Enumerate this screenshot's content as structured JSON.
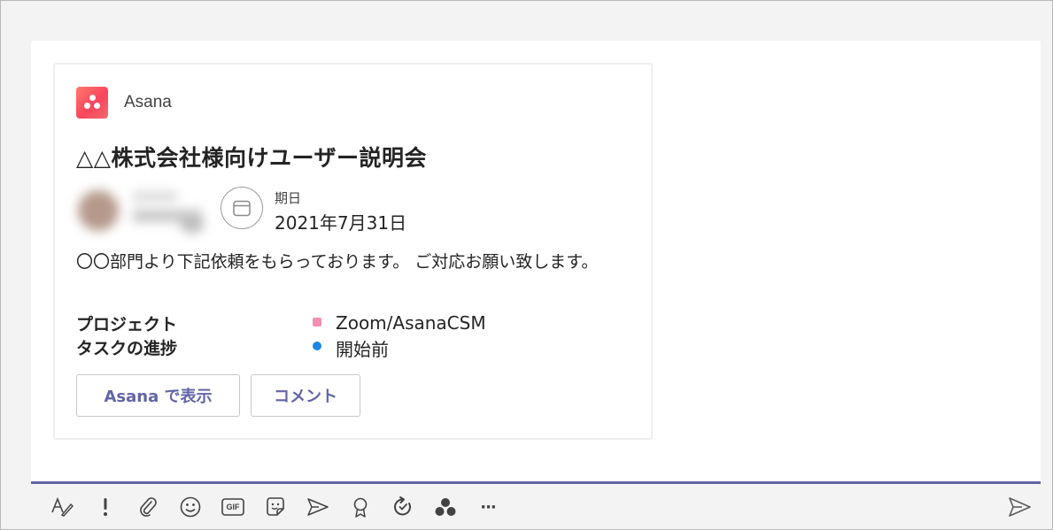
{
  "card": {
    "app_name": "Asana",
    "title": "△△株式会社様向けユーザー説明会",
    "due_label": "期日",
    "due_value": "2021年7月31日",
    "description": "〇〇部門より下記依頼をもらっております。 ご対応お願い致します。",
    "facts": [
      {
        "label": "プロジェクト",
        "value": "Zoom/AsanaCSM",
        "dot_color": "#f48fb1",
        "dot_shape": "square"
      },
      {
        "label": "タスクの進捗",
        "value": "開始前",
        "dot_color": "#1e88e5",
        "dot_shape": "circle"
      }
    ],
    "buttons": {
      "view_label": "Asana で表示",
      "comment_label": "コメント"
    }
  },
  "toolbar": {
    "icons": [
      "format-icon",
      "important-icon",
      "attach-icon",
      "emoji-icon",
      "gif-icon",
      "sticker-icon",
      "praise-send-icon",
      "praise-icon",
      "loop-icon",
      "asana-app-icon",
      "more-icon"
    ],
    "gif_text": "GIF",
    "more_text": "···"
  },
  "colors": {
    "accent": "#6264a7",
    "asana_brand": "#f95a5d"
  }
}
